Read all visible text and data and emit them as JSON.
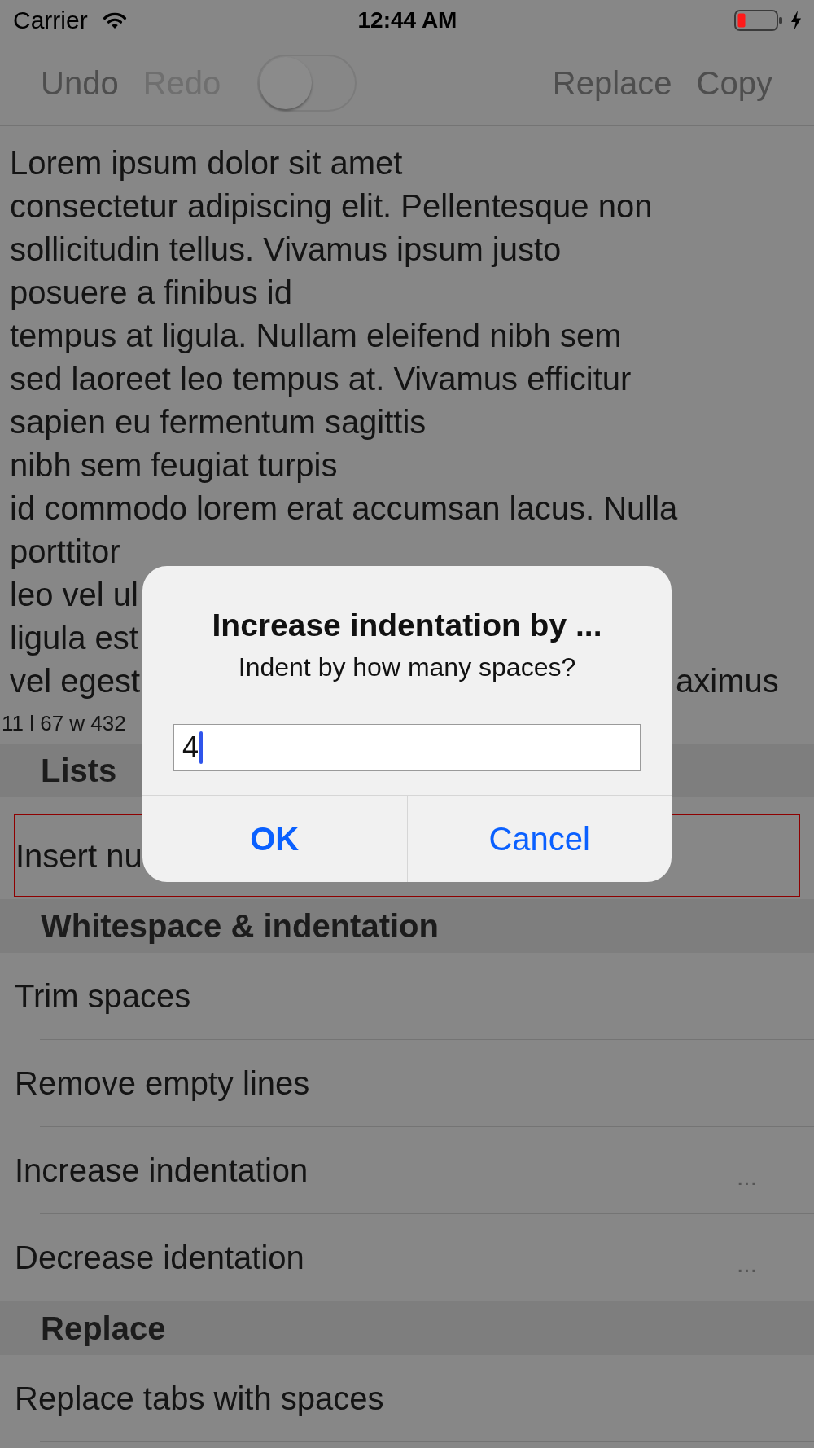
{
  "status_bar": {
    "carrier": "Carrier",
    "time": "12:44 AM"
  },
  "toolbar": {
    "left_buttons": [
      {
        "label": "Undo",
        "disabled": false
      },
      {
        "label": "Redo",
        "disabled": true
      }
    ],
    "switch": {
      "on": false
    },
    "right_buttons": [
      {
        "label": "Replace",
        "disabled": false
      },
      {
        "label": "Copy",
        "disabled": false
      }
    ]
  },
  "editor": {
    "lines": [
      {
        "text": "Lorem ipsum dolor sit amet"
      },
      {
        "text": "consectetur adipiscing elit. Pellentesque non"
      },
      {
        "text": "sollicitudin tellus. Vivamus ipsum justo"
      },
      {
        "text": "posuere a finibus id"
      },
      {
        "text": "tempus at ligula. Nullam eleifend nibh sem"
      },
      {
        "text": "sed laoreet leo tempus at. Vivamus efficitur"
      },
      {
        "text": "sapien eu fermentum sagittis"
      },
      {
        "text": "nibh sem feugiat turpis"
      },
      {
        "text": "id commodo lorem erat accumsan lacus. Nulla"
      },
      {
        "text": "porttitor"
      },
      {
        "text": "leo vel ul"
      },
      {
        "text": "ligula est"
      },
      {
        "text": "vel egest",
        "tail": "aximus"
      }
    ],
    "counter": "11 l 67 w 432"
  },
  "sections": [
    {
      "title": "Lists",
      "items": [
        {
          "label": "Insert nu",
          "selected": true
        }
      ]
    },
    {
      "title": "Whitespace & indentation",
      "items": [
        {
          "label": "Trim spaces",
          "selected": false
        },
        {
          "label": "Remove empty lines",
          "selected": false
        },
        {
          "label": "Increase indentation",
          "selected": false,
          "accessory": "..."
        },
        {
          "label": "Decrease identation",
          "selected": false,
          "accessory": "..."
        }
      ]
    },
    {
      "title": "Replace",
      "items": [
        {
          "label": "Replace tabs with spaces",
          "selected": false
        }
      ]
    }
  ],
  "dialog": {
    "title": "Increase indentation by ...",
    "message": "Indent by how many spaces?",
    "input": {
      "value": "4",
      "focused": true
    },
    "buttons": [
      {
        "label": "OK",
        "kind": "preferred"
      },
      {
        "label": "Cancel",
        "kind": "cancel"
      }
    ]
  }
}
